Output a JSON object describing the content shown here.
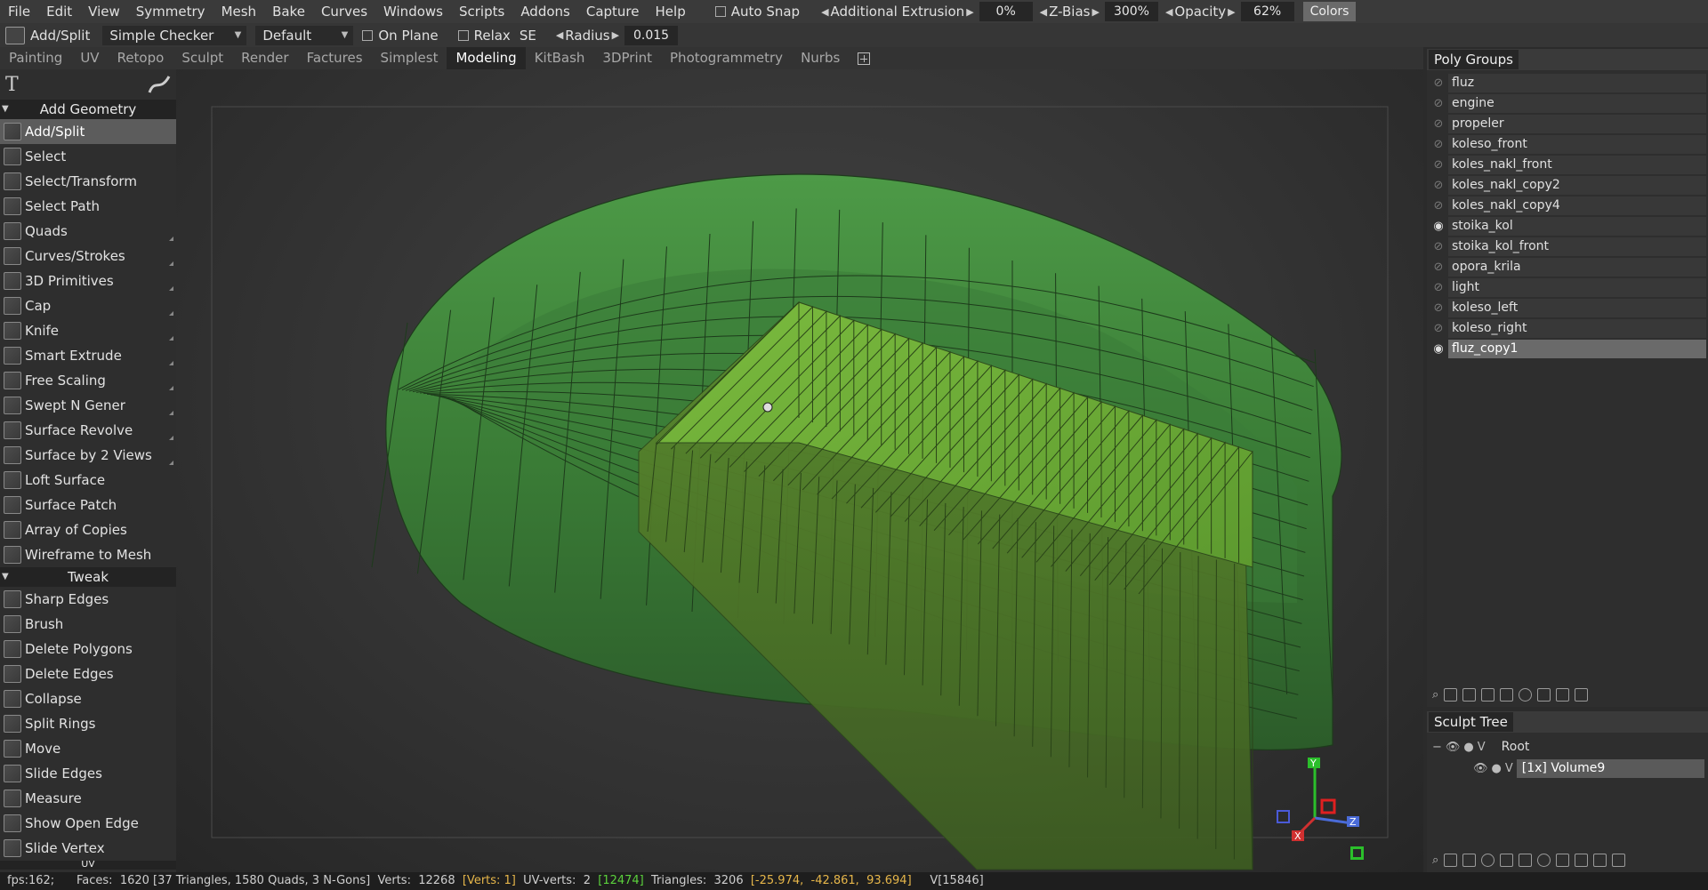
{
  "menu": [
    "File",
    "Edit",
    "View",
    "Symmetry",
    "Mesh",
    "Bake",
    "Curves",
    "Windows",
    "Scripts",
    "Addons",
    "Capture",
    "Help"
  ],
  "top_controls": {
    "auto_snap": "Auto Snap",
    "additional_extrusion_label": "Additional Extrusion",
    "additional_extrusion_value": "0%",
    "zbias_label": "Z-Bias",
    "zbias_value": "300%",
    "opacity_label": "Opacity",
    "opacity_value": "62%",
    "colors": "Colors"
  },
  "toolbar": {
    "tool_name": "Add/Split",
    "mode": "Simple Checker",
    "preset": "Default",
    "on_plane": "On Plane",
    "relax": "Relax",
    "se": "SE",
    "radius_label": "Radius",
    "radius_value": "0.015"
  },
  "tabs": [
    "Painting",
    "UV",
    "Retopo",
    "Sculpt",
    "Render",
    "Factures",
    "Simplest",
    "Modeling",
    "KitBash",
    "3DPrint",
    "Photogrammetry",
    "Nurbs"
  ],
  "active_tab": "Modeling",
  "left_panel": {
    "text_tool": "T",
    "add_geometry_title": "Add Geometry",
    "add_geometry": [
      {
        "label": "Add/Split",
        "active": true,
        "more": false
      },
      {
        "label": "Select",
        "more": false
      },
      {
        "label": "Select/Transform",
        "more": false
      },
      {
        "label": "Select Path",
        "more": false
      },
      {
        "label": "Quads",
        "more": true
      },
      {
        "label": "Curves/Strokes",
        "more": true
      },
      {
        "label": "3D Primitives",
        "more": true
      },
      {
        "label": "Cap",
        "more": true
      },
      {
        "label": "Knife",
        "more": true
      },
      {
        "label": "Smart Extrude",
        "more": true
      },
      {
        "label": "Free Scaling",
        "more": true
      },
      {
        "label": "Swept N Gener",
        "more": true
      },
      {
        "label": "Surface Revolve",
        "more": true
      },
      {
        "label": "Surface by 2 Views",
        "more": true
      },
      {
        "label": "Loft Surface",
        "more": false
      },
      {
        "label": "Surface Patch",
        "more": false
      },
      {
        "label": "Array of Copies",
        "more": false
      },
      {
        "label": "Wireframe to Mesh",
        "more": false
      }
    ],
    "tweak_title": "Tweak",
    "tweak": [
      {
        "label": "Sharp Edges"
      },
      {
        "label": "Brush"
      },
      {
        "label": "Delete Polygons"
      },
      {
        "label": "Delete Edges"
      },
      {
        "label": "Collapse"
      },
      {
        "label": "Split Rings"
      },
      {
        "label": "Move"
      },
      {
        "label": "Slide Edges"
      },
      {
        "label": "Measure"
      },
      {
        "label": "Show Open Edge"
      },
      {
        "label": "Slide Vertex"
      }
    ],
    "next_section": "UV"
  },
  "poly_groups": {
    "title": "Poly Groups",
    "items": [
      {
        "name": "fluz",
        "visible": false
      },
      {
        "name": "engine",
        "visible": false
      },
      {
        "name": "propeler",
        "visible": false
      },
      {
        "name": "koleso_front",
        "visible": false
      },
      {
        "name": "koles_nakl_front",
        "visible": false
      },
      {
        "name": "koles_nakl_copy2",
        "visible": false
      },
      {
        "name": "koles_nakl_copy4",
        "visible": false
      },
      {
        "name": "stoika_kol",
        "visible": true
      },
      {
        "name": "stoika_kol_front",
        "visible": false
      },
      {
        "name": "opora_krila",
        "visible": false
      },
      {
        "name": "light",
        "visible": false
      },
      {
        "name": "koleso_left",
        "visible": false
      },
      {
        "name": "koleso_right",
        "visible": false
      },
      {
        "name": "fluz_copy1",
        "visible": true,
        "selected": true
      }
    ]
  },
  "sculpt_tree": {
    "title": "Sculpt Tree",
    "root": "Root",
    "v": "V",
    "volume": "[1x]  Volume9"
  },
  "axis": {
    "x": "X",
    "y": "Y",
    "z": "Z"
  },
  "status": {
    "fps": "fps:162;",
    "faces_label": "Faces:",
    "faces": "1620 [37 Triangles, 1580 Quads, 3 N-Gons]",
    "verts_label": "Verts:",
    "verts": "12268",
    "verts_sel": "[Verts: 1]",
    "uv_label": "UV-verts:",
    "uv": "2",
    "uv_sel": "[12474]",
    "tri_label": "Triangles:",
    "tri": "3206",
    "coords": "[-25.974,  -42.861,  93.694]",
    "vid": "V[15846]"
  },
  "colors": {
    "mesh_dark": "#3f8a3c",
    "mesh_light": "#6aa838",
    "accent_selected": "#6a6a6a"
  }
}
